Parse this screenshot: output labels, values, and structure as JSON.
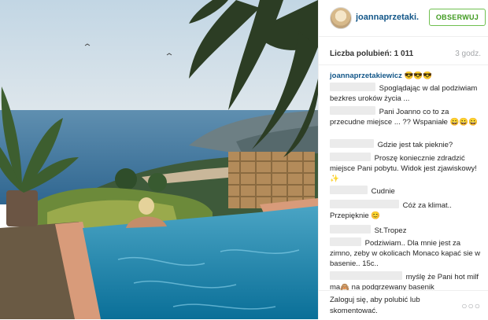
{
  "post": {
    "username": "joannaprzetaki...",
    "follow_label": "OBSERWUJ",
    "likes": "Liczba polubień: 1 011",
    "time": "3 godz."
  },
  "caption": {
    "username": "joannaprzetakiewicz",
    "emoji": "😎😎😎"
  },
  "comments": [
    {
      "text": "Spoglądając w dal podziwiam bezkres uroków życia ..."
    },
    {
      "text": "Pani Joanno co to za przecudne miejsce ... ?? Wspaniałe 😀😀😀"
    },
    {
      "text": "Gdzie jest tak pieknie?"
    },
    {
      "text": "Proszę koniecznie zdradzić miejsce Pani pobytu. Widok jest zjawiskowy! ✨"
    },
    {
      "text": "Cudnie"
    },
    {
      "text": "Cóż za klimat.. Przepięknie 😊"
    },
    {
      "text": "St.Tropez"
    },
    {
      "text": "Podziwiam.. Dla mnie jest za zimno, zeby w okolicach Monaco kapać sie w basenie.. 15c.."
    },
    {
      "text": "myślę że Pani hot milf ma🙈 na podgrzewany basenik"
    }
  ],
  "footer": {
    "login_prompt": "Zaloguj się, aby polubić lub skomentować.",
    "more": "○○○"
  }
}
